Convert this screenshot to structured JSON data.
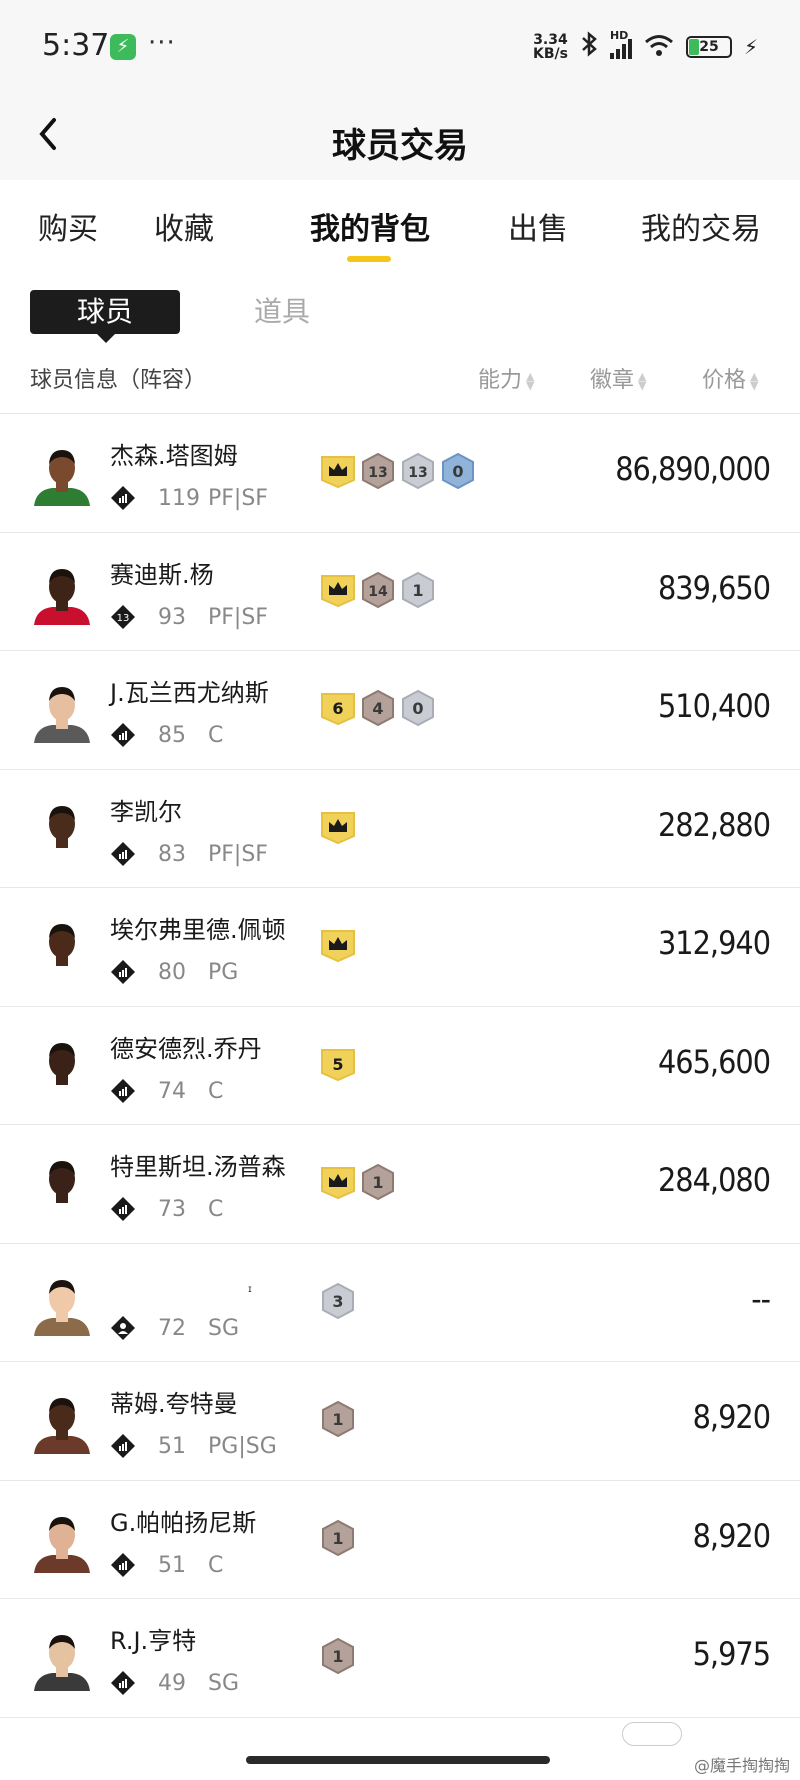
{
  "status_bar": {
    "time": "5:37",
    "dots": "···",
    "speed_top": "3.34",
    "speed_bottom": "KB/s",
    "hd": "HD",
    "battery": "25"
  },
  "header": {
    "title": "球员交易"
  },
  "tabs": [
    {
      "label": "购买"
    },
    {
      "label": "收藏"
    },
    {
      "label": "我的背包"
    },
    {
      "label": "出售"
    },
    {
      "label": "我的交易"
    }
  ],
  "subtabs": [
    {
      "label": "球员"
    },
    {
      "label": "道具"
    }
  ],
  "columns": {
    "info": "球员信息（阵容）",
    "ability": "能力",
    "badge": "徽章",
    "price": "价格"
  },
  "colors": {
    "accent": "#f5c518",
    "gold_badge": "#f0d25a",
    "bronze_badge": "#b4a29a",
    "silver_badge": "#c9ccd3",
    "blue_badge": "#8fb3d9"
  },
  "players": [
    {
      "name": "杰森.塔图姆",
      "rating": "119",
      "position": "PF|SF",
      "price": "86,890,000",
      "skin": "#7a4a2e",
      "jersey": "#2f7d32",
      "badges": [
        {
          "type": "crown",
          "color": "gold"
        },
        {
          "text": "13",
          "color": "bronze"
        },
        {
          "text": "13",
          "color": "silver"
        },
        {
          "text": "0",
          "color": "blue"
        }
      ]
    },
    {
      "name": "赛迪斯.杨",
      "rating": "93",
      "position": "PF|SF",
      "price": "839,650",
      "skin": "#3d2417",
      "jersey": "#c8102e",
      "stat_icon": "number-13",
      "badges": [
        {
          "type": "crown",
          "color": "gold"
        },
        {
          "text": "14",
          "color": "bronze"
        },
        {
          "text": "1",
          "color": "silver"
        }
      ]
    },
    {
      "name": "J.瓦兰西尤纳斯",
      "rating": "85",
      "position": "C",
      "price": "510,400",
      "skin": "#e6bfa0",
      "jersey": "#5a5a5a",
      "badges": [
        {
          "text": "6",
          "color": "gold"
        },
        {
          "text": "4",
          "color": "bronze"
        },
        {
          "text": "0",
          "color": "silver"
        }
      ]
    },
    {
      "name": "李凯尔",
      "rating": "83",
      "position": "PF|SF",
      "price": "282,880",
      "skin": "#4a2c1d",
      "jersey": "#ffffff",
      "badges": [
        {
          "type": "crown",
          "color": "gold"
        }
      ]
    },
    {
      "name": "埃尔弗里德.佩顿",
      "rating": "80",
      "position": "PG",
      "price": "312,940",
      "skin": "#4b2a1a",
      "jersey": "#ffffff",
      "badges": [
        {
          "type": "crown",
          "color": "gold"
        }
      ]
    },
    {
      "name": "德安德烈.乔丹",
      "rating": "74",
      "position": "C",
      "price": "465,600",
      "skin": "#3b2218",
      "jersey": "#ffffff",
      "badges": [
        {
          "text": "5",
          "color": "gold"
        }
      ]
    },
    {
      "name": "特里斯坦.汤普森",
      "rating": "73",
      "position": "C",
      "price": "284,080",
      "skin": "#3a2218",
      "jersey": "#ffffff",
      "badges": [
        {
          "type": "crown",
          "color": "gold"
        },
        {
          "text": "1",
          "color": "bronze"
        }
      ]
    },
    {
      "name": "",
      "rating": "72",
      "position": "SG",
      "price": "--",
      "skin": "#f0c9a8",
      "jersey": "#8b6b4a",
      "stat_icon": "person",
      "tick": "ɪ",
      "badges": [
        {
          "text": "3",
          "color": "silver"
        }
      ]
    },
    {
      "name": "蒂姆.夸特曼",
      "rating": "51",
      "position": "PG|SG",
      "price": "8,920",
      "skin": "#4a2a1a",
      "jersey": "#6b3a2a",
      "badges": [
        {
          "text": "1",
          "color": "bronze"
        }
      ]
    },
    {
      "name": "G.帕帕扬尼斯",
      "rating": "51",
      "position": "C",
      "price": "8,920",
      "skin": "#e0b295",
      "jersey": "#6b3a2a",
      "badges": [
        {
          "text": "1",
          "color": "bronze"
        }
      ]
    },
    {
      "name": "R.J.亨特",
      "rating": "49",
      "position": "SG",
      "price": "5,975",
      "skin": "#e6c3a0",
      "jersey": "#3a3a3a",
      "badges": [
        {
          "text": "1",
          "color": "bronze"
        }
      ]
    }
  ],
  "watermark": "@魔手掏掏掏"
}
